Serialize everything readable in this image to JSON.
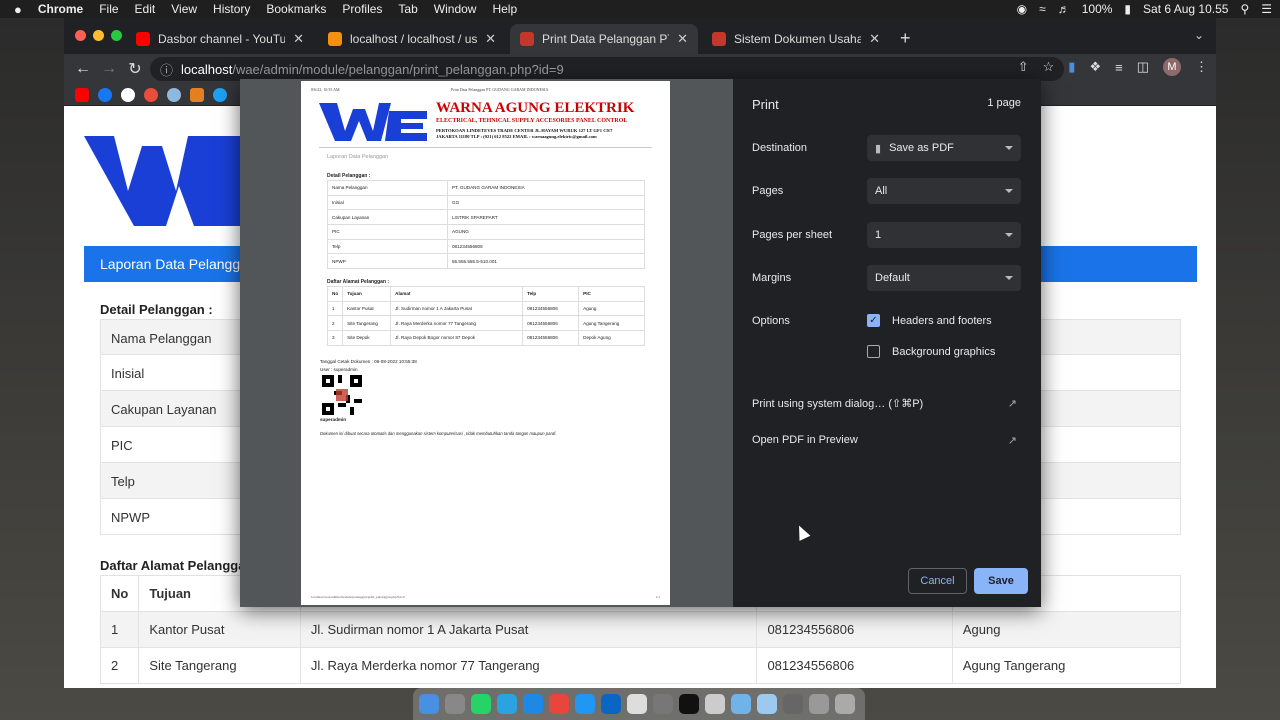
{
  "menubar": {
    "apple": "",
    "app": "Chrome",
    "items": [
      "File",
      "Edit",
      "View",
      "History",
      "Bookmarks",
      "Profiles",
      "Tab",
      "Window",
      "Help"
    ],
    "battery": "100%",
    "datetime": "Sat 6 Aug  10.55"
  },
  "tabs": [
    {
      "title": "Dasbor channel - YouTube Studio",
      "favicon_color": "#ff0000"
    },
    {
      "title": "localhost / localhost / usaha / p",
      "favicon_color": "#f29111"
    },
    {
      "title": "Print Data Pelanggan PT. GUDA",
      "favicon_color": "#c0392b"
    },
    {
      "title": "Sistem Dokumen Usaha",
      "favicon_color": "#c0392b"
    }
  ],
  "address": {
    "host": "localhost",
    "path": "/wae/admin/module/pelanggan/print_pelanggan.php?id=9"
  },
  "profile_initial": "M",
  "page": {
    "banner": "Laporan Data Pelanggan",
    "detail_heading": "Detail Pelanggan :",
    "detail_rows": [
      "Nama Pelanggan",
      "Inisial",
      "Cakupan Layanan",
      "PIC",
      "Telp",
      "NPWP"
    ],
    "alamat_heading": "Daftar Alamat Pelanggan :",
    "alamat_cols": [
      "No",
      "Tujuan",
      "",
      "",
      ""
    ],
    "alamat_rows": [
      [
        "1",
        "Kantor Pusat",
        "Jl. Sudirman nomor 1 A Jakarta Pusat",
        "081234556806",
        "Agung"
      ],
      [
        "2",
        "Site Tangerang",
        "Jl. Raya Merderka nomor 77 Tangerang",
        "081234556806",
        "Agung Tangerang"
      ]
    ]
  },
  "preview": {
    "header_left": "8/6/22, 10:55 AM",
    "header_center": "Print Data Pelanggan PT. GUDANG GARAM INDONESIA",
    "company": "WARNA AGUNG ELEKTRIK",
    "tagline": "ELECTRICAL, TEHNICAL SUPPLY ACCESORIES PANEL CONTROL",
    "address1": "PERTOKOAN LINDETEVES TRADE CENTER JL.HAYAM WURUK 127 LT GF1 C9/7",
    "address2": "JAKARTA 11180 TLP : (021) 612 8522 EMAIL : warnaagung.elektric@gmail.com",
    "report_title": "Laporan Data Pelanggan",
    "detail_heading": "Detail Pelanggan :",
    "detail": [
      [
        "Nama Pelanggan",
        "PT. GUDANG GARAM INDONESIA"
      ],
      [
        "Inisial",
        "GG"
      ],
      [
        "Cakupan Layanan",
        "LISTRIK SPAREPART"
      ],
      [
        "PIC",
        "AGUNG"
      ],
      [
        "Telp",
        "081234556806"
      ],
      [
        "NPWP",
        "55.555.555.5-510.001"
      ]
    ],
    "alamat_heading": "Daftar Alamat Pelanggan :",
    "alamat_cols": [
      "No",
      "Tujuan",
      "Alamat",
      "Telp",
      "PIC"
    ],
    "alamat": [
      [
        "1",
        "Kantor Pusat",
        "Jl. Sudirman nomor 1 A Jakarta Pusat",
        "081234556806",
        "Agung"
      ],
      [
        "2",
        "Site Tangerang",
        "Jl. Raya Merderka nomor 77 Tangerang",
        "081234556806",
        "Agung Tangerang"
      ],
      [
        "3",
        "Site Depok",
        "Jl. Raya Depok Bogor nomor 87 Depok",
        "081234556806",
        "Depok Agung"
      ]
    ],
    "print_date": "Tanggal Cetak Dokumen : 06-08-2022 10:55:38",
    "user_line": "User : superadmin",
    "signer": "superadmin",
    "disclaimer": "Dokumen ini dibuat secara otomatis dan menggunakan sistem komputerisasi , tidak membutuhkan tanda tangan maupun paraf.",
    "footer_left": "localhost/wae/admin/module/pelanggan/print_pelanggan.php?id=9",
    "footer_right": "1/1"
  },
  "print": {
    "title": "Print",
    "page_count": "1 page",
    "destination_label": "Destination",
    "destination_value": "Save as PDF",
    "pages_label": "Pages",
    "pages_value": "All",
    "pps_label": "Pages per sheet",
    "pps_value": "1",
    "margins_label": "Margins",
    "margins_value": "Default",
    "options_label": "Options",
    "headers_footers": "Headers and footers",
    "headers_footers_checked": true,
    "background_graphics": "Background graphics",
    "background_graphics_checked": false,
    "system_dialog": "Print using system dialog… (⇧⌘P)",
    "open_preview": "Open PDF in Preview",
    "cancel": "Cancel",
    "save": "Save"
  },
  "colors": {
    "brand_blue": "#1a3fd6",
    "banner_blue": "#1a73e8",
    "company_red": "#c00000",
    "accent": "#8ab4f8"
  }
}
